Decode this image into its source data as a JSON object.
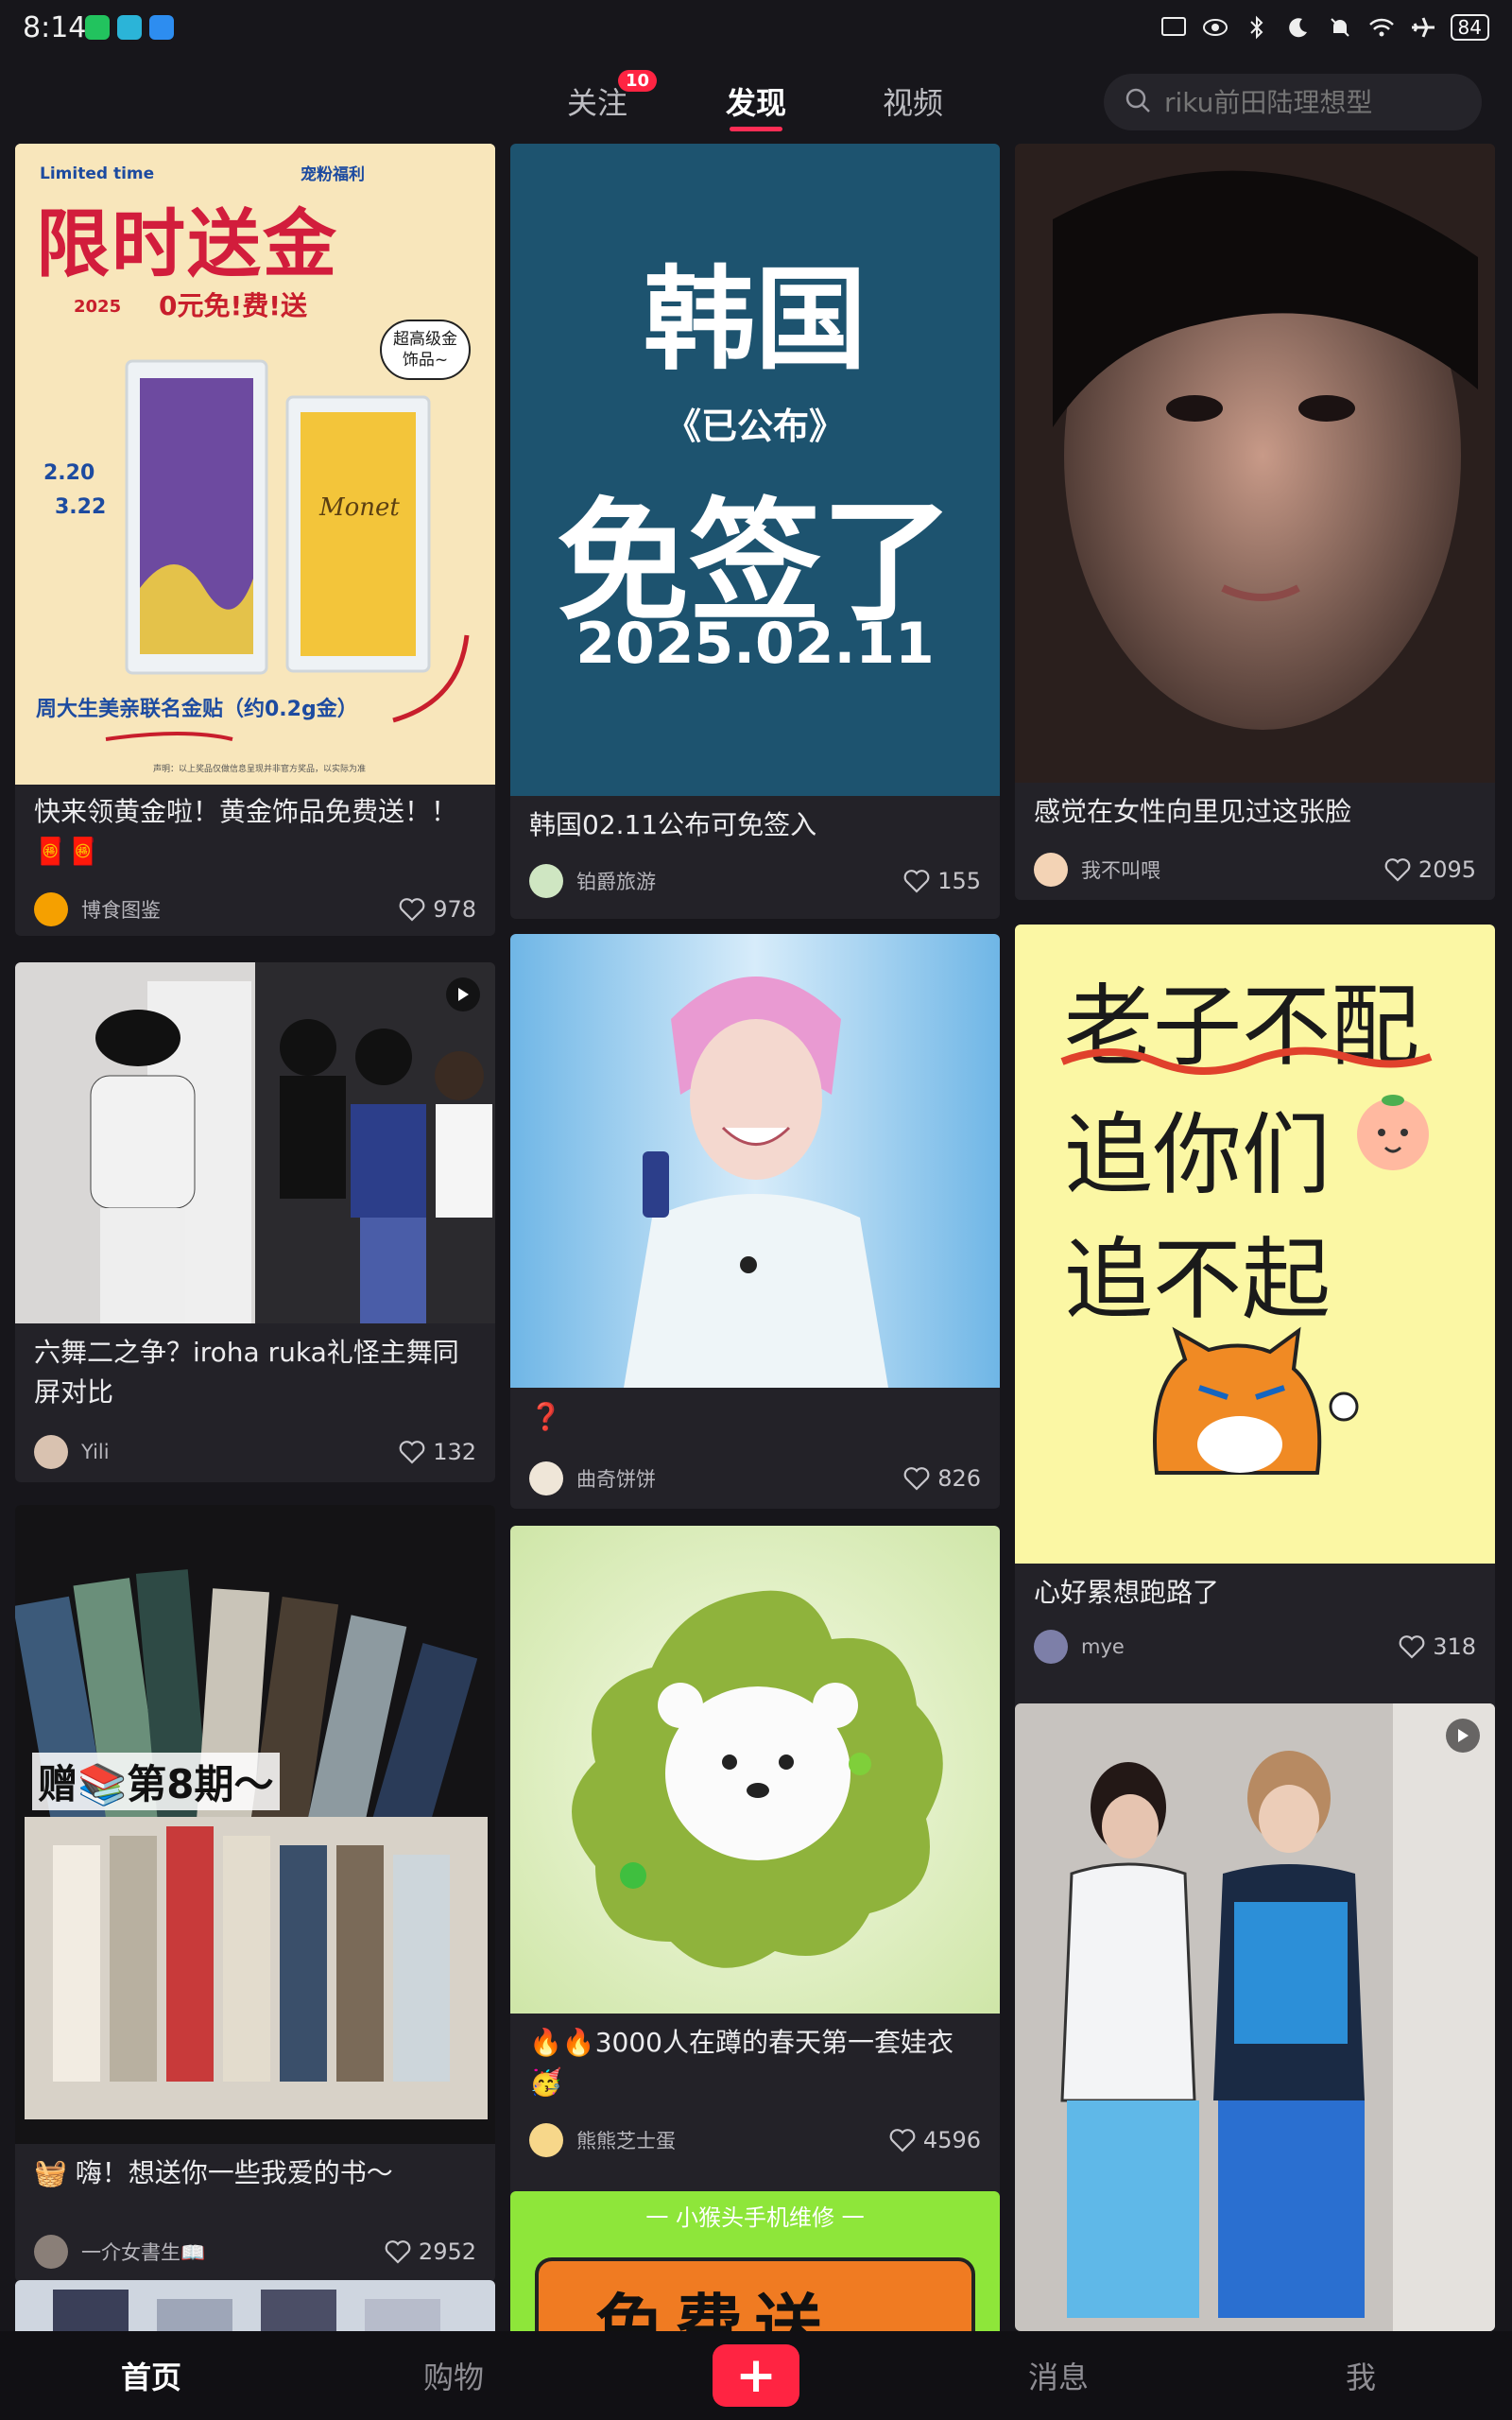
{
  "status_bar": {
    "time": "8:14",
    "battery": "84"
  },
  "top_tabs": {
    "follow": "关注",
    "follow_badge": "10",
    "discover": "发现",
    "video": "视频"
  },
  "search": {
    "placeholder": "riku前田陆理想型"
  },
  "cards": [
    {
      "title": "快来领黄金啦！黄金饰品免费送！！🧧🧧",
      "author": "博食图鉴",
      "likes": "978",
      "img": {
        "en_top": "Limited time",
        "tag": "宠粉福利",
        "big": "限时送金",
        "year": "2025",
        "sub": "0元免!费!送",
        "bubble": "超高级金饰品~",
        "date1": "2.20",
        "date2": "3.22",
        "brand": "Monet",
        "footer": "周大生美亲联名金贴（约0.2g金）",
        "note": "声明：以上奖品仅做信息呈现并非官方奖品，以实际为准"
      }
    },
    {
      "title": "韩国02.11公布可免签入",
      "author": "铂爵旅游",
      "likes": "155",
      "img": {
        "line1": "韩国",
        "line2": "《已公布》",
        "line3": "免签了",
        "line4": "2025.02.11"
      }
    },
    {
      "title": "感觉在女性向里见过这张脸",
      "author": "我不叫喂",
      "likes": "2095"
    },
    {
      "title": "六舞二之争？iroha ruka礼怪主舞同屏对比",
      "author": "Yili",
      "likes": "132"
    },
    {
      "title": "❓",
      "author": "曲奇饼饼",
      "likes": "826"
    },
    {
      "title": "心好累想跑路了",
      "author": "mye",
      "likes": "318",
      "img": {
        "line1": "老子不配",
        "line2": "追你们",
        "line3": "追不起"
      }
    },
    {
      "title": "🧺 嗨！想送你一些我爱的书～",
      "author": "一介女書生📖",
      "likes": "2952",
      "img": {
        "overlay": "赠📚第8期～"
      }
    },
    {
      "title": "🔥🔥3000人在蹲的春天第一套娃衣🥳",
      "author": "熊熊芝士蛋",
      "likes": "4596"
    },
    {
      "title": "",
      "author": "",
      "likes": "",
      "img": {
        "top": "一 小猴头手机维修 一",
        "big": "免费送"
      }
    },
    {
      "title": "",
      "author": "",
      "likes": ""
    },
    {
      "title": "",
      "author": "",
      "likes": ""
    }
  ],
  "bottom_nav": {
    "home": "首页",
    "shop": "购物",
    "plus": "+",
    "messages": "消息",
    "me": "我"
  },
  "colors": {
    "accent": "#ff2442",
    "background": "#17161b",
    "card": "#232228"
  }
}
